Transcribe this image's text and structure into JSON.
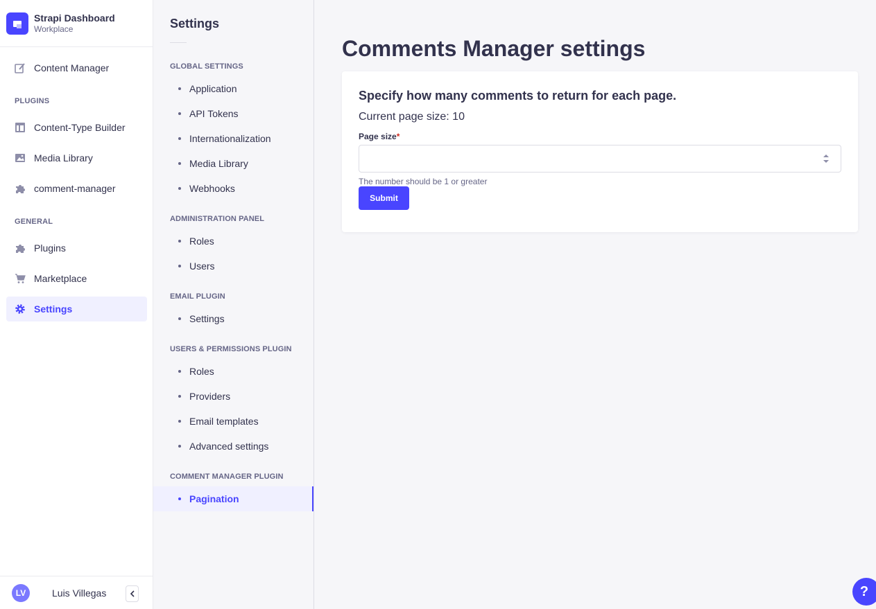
{
  "brand": {
    "name": "Strapi Dashboard",
    "workspace": "Workplace"
  },
  "mainnav": {
    "content_manager": "Content Manager",
    "plugins_section": "PLUGINS",
    "plugins": [
      "Content-Type Builder",
      "Media Library",
      "comment-manager"
    ],
    "general_section": "GENERAL",
    "general": [
      "Plugins",
      "Marketplace",
      "Settings"
    ],
    "active": "Settings"
  },
  "user": {
    "initials": "LV",
    "name": "Luis Villegas"
  },
  "subnav": {
    "title": "Settings",
    "sections": [
      {
        "title": "GLOBAL SETTINGS",
        "items": [
          "Application",
          "API Tokens",
          "Internationalization",
          "Media Library",
          "Webhooks"
        ]
      },
      {
        "title": "ADMINISTRATION PANEL",
        "items": [
          "Roles",
          "Users"
        ]
      },
      {
        "title": "EMAIL PLUGIN",
        "items": [
          "Settings"
        ]
      },
      {
        "title": "USERS & PERMISSIONS PLUGIN",
        "items": [
          "Roles",
          "Providers",
          "Email templates",
          "Advanced settings"
        ]
      },
      {
        "title": "COMMENT MANAGER PLUGIN",
        "items": [
          "Pagination"
        ]
      }
    ],
    "active": "Pagination"
  },
  "main": {
    "title": "Comments Manager settings",
    "card": {
      "heading": "Specify how many comments to return for each page.",
      "current": "Current page size: 10",
      "field_label": "Page size",
      "field_required": "*",
      "field_value": "",
      "field_placeholder": "",
      "hint": "The number should be 1 or greater",
      "submit_label": "Submit"
    }
  },
  "help": {
    "label": "?"
  },
  "colors": {
    "primary": "#4945ff",
    "active_bg": "#f0f0ff",
    "required": "#d02b20"
  }
}
